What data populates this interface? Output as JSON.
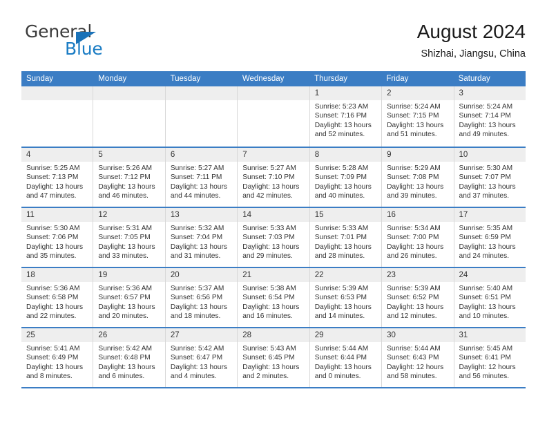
{
  "logo": {
    "word1": "General",
    "word2": "Blue",
    "triangle_color": "#1a72b8",
    "blue_color": "#1a7cc4"
  },
  "header": {
    "title": "August 2024",
    "subtitle": "Shizhai, Jiangsu, China"
  },
  "theme": {
    "header_blue": "#3b7dc4",
    "day_strip_gray": "#eeeeee",
    "cell_border": "#d8d8d8"
  },
  "weekdays": [
    "Sunday",
    "Monday",
    "Tuesday",
    "Wednesday",
    "Thursday",
    "Friday",
    "Saturday"
  ],
  "weeks": [
    [
      {
        "date": "",
        "empty": true
      },
      {
        "date": "",
        "empty": true
      },
      {
        "date": "",
        "empty": true
      },
      {
        "date": "",
        "empty": true
      },
      {
        "date": "1",
        "sunrise": "Sunrise: 5:23 AM",
        "sunset": "Sunset: 7:16 PM",
        "daylight": "Daylight: 13 hours and 52 minutes."
      },
      {
        "date": "2",
        "sunrise": "Sunrise: 5:24 AM",
        "sunset": "Sunset: 7:15 PM",
        "daylight": "Daylight: 13 hours and 51 minutes."
      },
      {
        "date": "3",
        "sunrise": "Sunrise: 5:24 AM",
        "sunset": "Sunset: 7:14 PM",
        "daylight": "Daylight: 13 hours and 49 minutes."
      }
    ],
    [
      {
        "date": "4",
        "sunrise": "Sunrise: 5:25 AM",
        "sunset": "Sunset: 7:13 PM",
        "daylight": "Daylight: 13 hours and 47 minutes."
      },
      {
        "date": "5",
        "sunrise": "Sunrise: 5:26 AM",
        "sunset": "Sunset: 7:12 PM",
        "daylight": "Daylight: 13 hours and 46 minutes."
      },
      {
        "date": "6",
        "sunrise": "Sunrise: 5:27 AM",
        "sunset": "Sunset: 7:11 PM",
        "daylight": "Daylight: 13 hours and 44 minutes."
      },
      {
        "date": "7",
        "sunrise": "Sunrise: 5:27 AM",
        "sunset": "Sunset: 7:10 PM",
        "daylight": "Daylight: 13 hours and 42 minutes."
      },
      {
        "date": "8",
        "sunrise": "Sunrise: 5:28 AM",
        "sunset": "Sunset: 7:09 PM",
        "daylight": "Daylight: 13 hours and 40 minutes."
      },
      {
        "date": "9",
        "sunrise": "Sunrise: 5:29 AM",
        "sunset": "Sunset: 7:08 PM",
        "daylight": "Daylight: 13 hours and 39 minutes."
      },
      {
        "date": "10",
        "sunrise": "Sunrise: 5:30 AM",
        "sunset": "Sunset: 7:07 PM",
        "daylight": "Daylight: 13 hours and 37 minutes."
      }
    ],
    [
      {
        "date": "11",
        "sunrise": "Sunrise: 5:30 AM",
        "sunset": "Sunset: 7:06 PM",
        "daylight": "Daylight: 13 hours and 35 minutes."
      },
      {
        "date": "12",
        "sunrise": "Sunrise: 5:31 AM",
        "sunset": "Sunset: 7:05 PM",
        "daylight": "Daylight: 13 hours and 33 minutes."
      },
      {
        "date": "13",
        "sunrise": "Sunrise: 5:32 AM",
        "sunset": "Sunset: 7:04 PM",
        "daylight": "Daylight: 13 hours and 31 minutes."
      },
      {
        "date": "14",
        "sunrise": "Sunrise: 5:33 AM",
        "sunset": "Sunset: 7:03 PM",
        "daylight": "Daylight: 13 hours and 29 minutes."
      },
      {
        "date": "15",
        "sunrise": "Sunrise: 5:33 AM",
        "sunset": "Sunset: 7:01 PM",
        "daylight": "Daylight: 13 hours and 28 minutes."
      },
      {
        "date": "16",
        "sunrise": "Sunrise: 5:34 AM",
        "sunset": "Sunset: 7:00 PM",
        "daylight": "Daylight: 13 hours and 26 minutes."
      },
      {
        "date": "17",
        "sunrise": "Sunrise: 5:35 AM",
        "sunset": "Sunset: 6:59 PM",
        "daylight": "Daylight: 13 hours and 24 minutes."
      }
    ],
    [
      {
        "date": "18",
        "sunrise": "Sunrise: 5:36 AM",
        "sunset": "Sunset: 6:58 PM",
        "daylight": "Daylight: 13 hours and 22 minutes."
      },
      {
        "date": "19",
        "sunrise": "Sunrise: 5:36 AM",
        "sunset": "Sunset: 6:57 PM",
        "daylight": "Daylight: 13 hours and 20 minutes."
      },
      {
        "date": "20",
        "sunrise": "Sunrise: 5:37 AM",
        "sunset": "Sunset: 6:56 PM",
        "daylight": "Daylight: 13 hours and 18 minutes."
      },
      {
        "date": "21",
        "sunrise": "Sunrise: 5:38 AM",
        "sunset": "Sunset: 6:54 PM",
        "daylight": "Daylight: 13 hours and 16 minutes."
      },
      {
        "date": "22",
        "sunrise": "Sunrise: 5:39 AM",
        "sunset": "Sunset: 6:53 PM",
        "daylight": "Daylight: 13 hours and 14 minutes."
      },
      {
        "date": "23",
        "sunrise": "Sunrise: 5:39 AM",
        "sunset": "Sunset: 6:52 PM",
        "daylight": "Daylight: 13 hours and 12 minutes."
      },
      {
        "date": "24",
        "sunrise": "Sunrise: 5:40 AM",
        "sunset": "Sunset: 6:51 PM",
        "daylight": "Daylight: 13 hours and 10 minutes."
      }
    ],
    [
      {
        "date": "25",
        "sunrise": "Sunrise: 5:41 AM",
        "sunset": "Sunset: 6:49 PM",
        "daylight": "Daylight: 13 hours and 8 minutes."
      },
      {
        "date": "26",
        "sunrise": "Sunrise: 5:42 AM",
        "sunset": "Sunset: 6:48 PM",
        "daylight": "Daylight: 13 hours and 6 minutes."
      },
      {
        "date": "27",
        "sunrise": "Sunrise: 5:42 AM",
        "sunset": "Sunset: 6:47 PM",
        "daylight": "Daylight: 13 hours and 4 minutes."
      },
      {
        "date": "28",
        "sunrise": "Sunrise: 5:43 AM",
        "sunset": "Sunset: 6:45 PM",
        "daylight": "Daylight: 13 hours and 2 minutes."
      },
      {
        "date": "29",
        "sunrise": "Sunrise: 5:44 AM",
        "sunset": "Sunset: 6:44 PM",
        "daylight": "Daylight: 13 hours and 0 minutes."
      },
      {
        "date": "30",
        "sunrise": "Sunrise: 5:44 AM",
        "sunset": "Sunset: 6:43 PM",
        "daylight": "Daylight: 12 hours and 58 minutes."
      },
      {
        "date": "31",
        "sunrise": "Sunrise: 5:45 AM",
        "sunset": "Sunset: 6:41 PM",
        "daylight": "Daylight: 12 hours and 56 minutes."
      }
    ]
  ]
}
